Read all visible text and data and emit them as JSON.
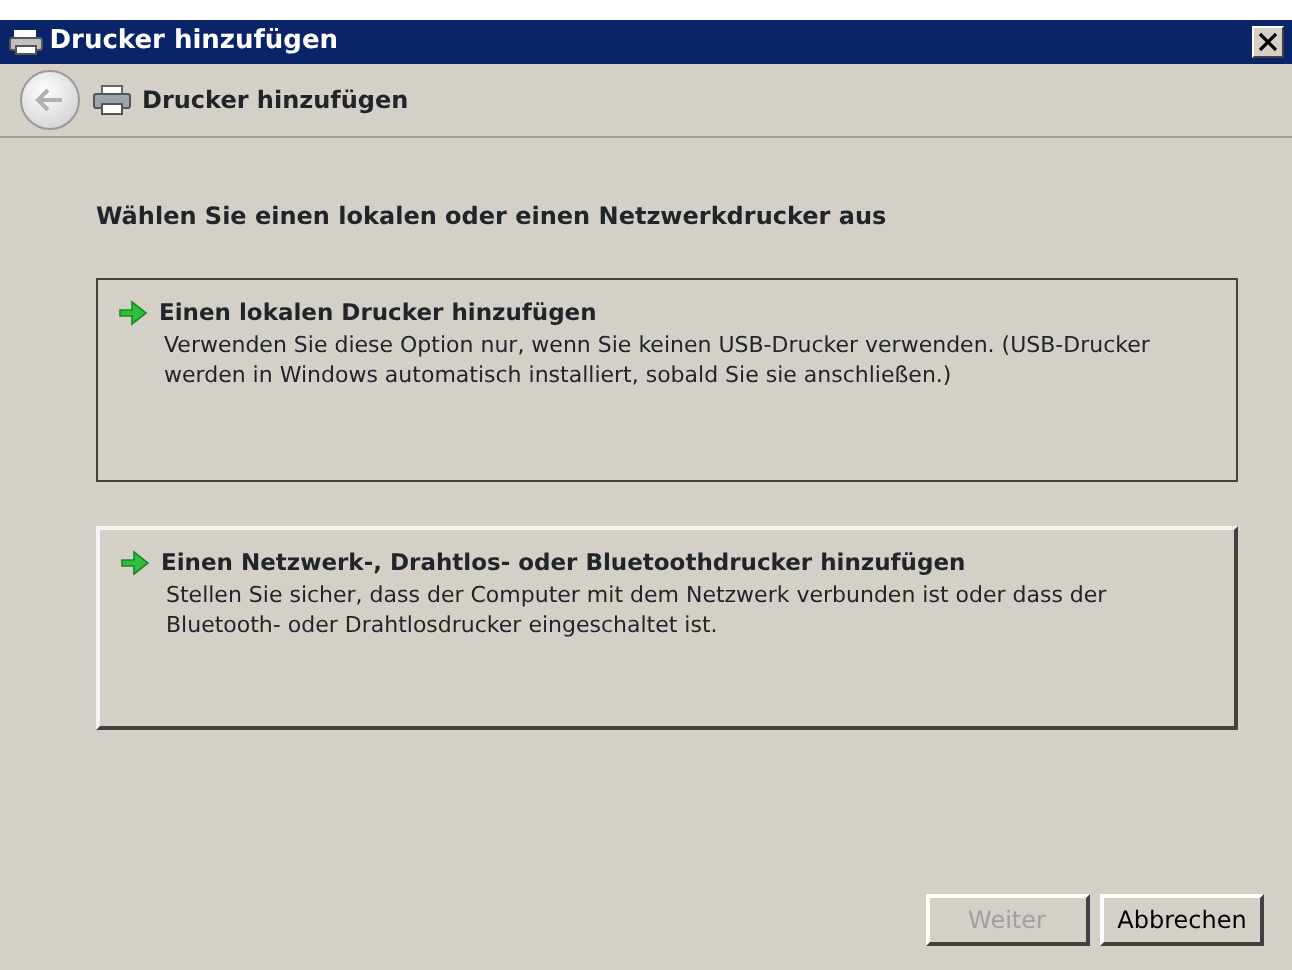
{
  "window": {
    "title": "Drucker hinzufügen"
  },
  "header": {
    "title": "Drucker hinzufügen",
    "back_disabled": true
  },
  "heading": "Wählen Sie einen lokalen oder einen Netzwerkdrucker aus",
  "options": [
    {
      "title": "Einen lokalen Drucker hinzufügen",
      "description": "Verwenden Sie diese Option nur, wenn Sie keinen USB-Drucker verwenden. (USB-Drucker werden in Windows automatisch installiert, sobald Sie sie anschließen.)",
      "selected": true
    },
    {
      "title": "Einen Netzwerk-, Drahtlos- oder Bluetoothdrucker hinzufügen",
      "description": "Stellen Sie sicher, dass der Computer mit dem Netzwerk verbunden ist oder dass der Bluetooth- oder Drahtlosdrucker eingeschaltet ist.",
      "selected": false
    }
  ],
  "buttons": [
    {
      "label": "Weiter",
      "disabled": true
    },
    {
      "label": "Abbrechen",
      "disabled": false
    }
  ]
}
